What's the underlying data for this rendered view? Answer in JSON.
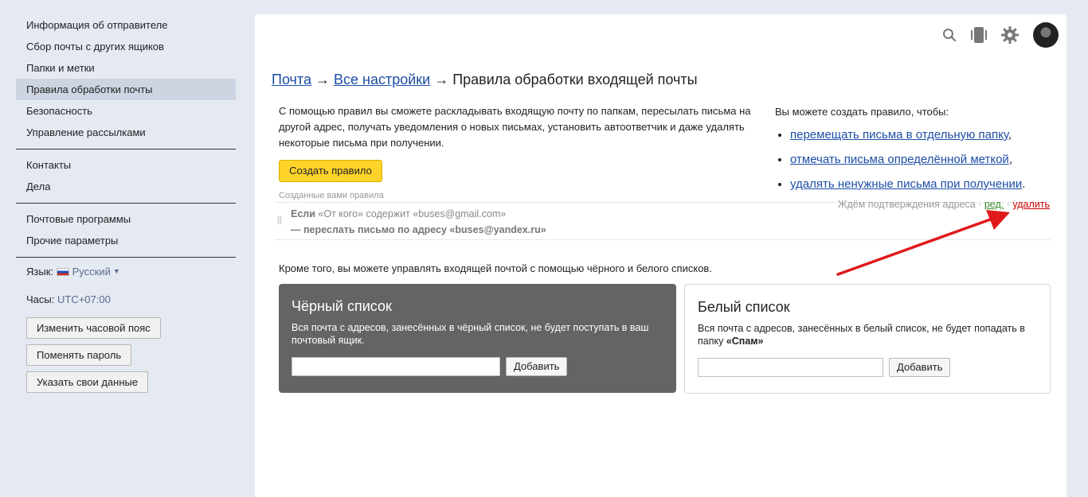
{
  "sidebar": {
    "items": [
      {
        "label": "Информация об отправителе"
      },
      {
        "label": "Сбор почты с других ящиков"
      },
      {
        "label": "Папки и метки"
      },
      {
        "label": "Правила обработки почты"
      },
      {
        "label": "Безопасность"
      },
      {
        "label": "Управление рассылками"
      }
    ],
    "items2": [
      {
        "label": "Контакты"
      },
      {
        "label": "Дела"
      }
    ],
    "items3": [
      {
        "label": "Почтовые программы"
      },
      {
        "label": "Прочие параметры"
      }
    ],
    "lang_label": "Язык:",
    "lang_value": "Русский",
    "tz_label": "Часы:",
    "tz_value": "UTC+07:00",
    "buttons": {
      "change_tz": "Изменить часовой пояс",
      "change_password": "Поменять пароль",
      "my_data": "Указать свои данные"
    }
  },
  "header": {
    "icons": [
      "search-icon",
      "phone-icon",
      "gear-icon",
      "avatar"
    ]
  },
  "breadcrumb": {
    "mail": "Почта",
    "all_settings": "Все настройки",
    "current": "Правила обработки входящей почты",
    "sep": "→"
  },
  "intro": {
    "text": "С помощью правил вы сможете раскладывать входящую почту по папкам, пересылать письма на другой адрес, получать уведомления о новых письмах, установить автоответчик и даже удалять некоторые письма при получении.",
    "create_button": "Создать правило"
  },
  "right_box": {
    "lead": "Вы можете создать правило, чтобы:",
    "links": [
      {
        "label": "перемещать письма в отдельную папку"
      },
      {
        "label": "отмечать письма определённой меткой"
      },
      {
        "label": "удалять ненужные письма при получении"
      }
    ],
    "suffix_comma": ",",
    "suffix_dot": "."
  },
  "rules": {
    "label": "Созданные вами правила",
    "items": [
      {
        "if": "Если",
        "condition": "«От кого» содержит «buses@gmail.com»",
        "action": "— переслать письмо по адресу «buses@yandex.ru»",
        "status": "Ждём подтверждения адреса",
        "edit": "ред.",
        "delete": "удалить"
      }
    ]
  },
  "lists": {
    "intro": "Кроме того, вы можете управлять входящей почтой с помощью чёрного и белого списков.",
    "black": {
      "title": "Чёрный список",
      "desc": "Вся почта с адресов, занесённых в чёрный список, не будет поступать в ваш почтовый ящик.",
      "button": "Добавить",
      "input_value": ""
    },
    "white": {
      "title": "Белый список",
      "desc_pre": "Вся почта с адресов, занесённых в белый список, не будет попадать в папку ",
      "desc_bold": "«Спам»",
      "button": "Добавить",
      "input_value": ""
    }
  },
  "colors": {
    "accent_button": "#fed42b",
    "link": "#1d4ea6",
    "delete_link": "#cc0000",
    "edit_link": "#3a8a2a",
    "black_list_bg": "#646464",
    "annotation_arrow": "#e0191b"
  }
}
